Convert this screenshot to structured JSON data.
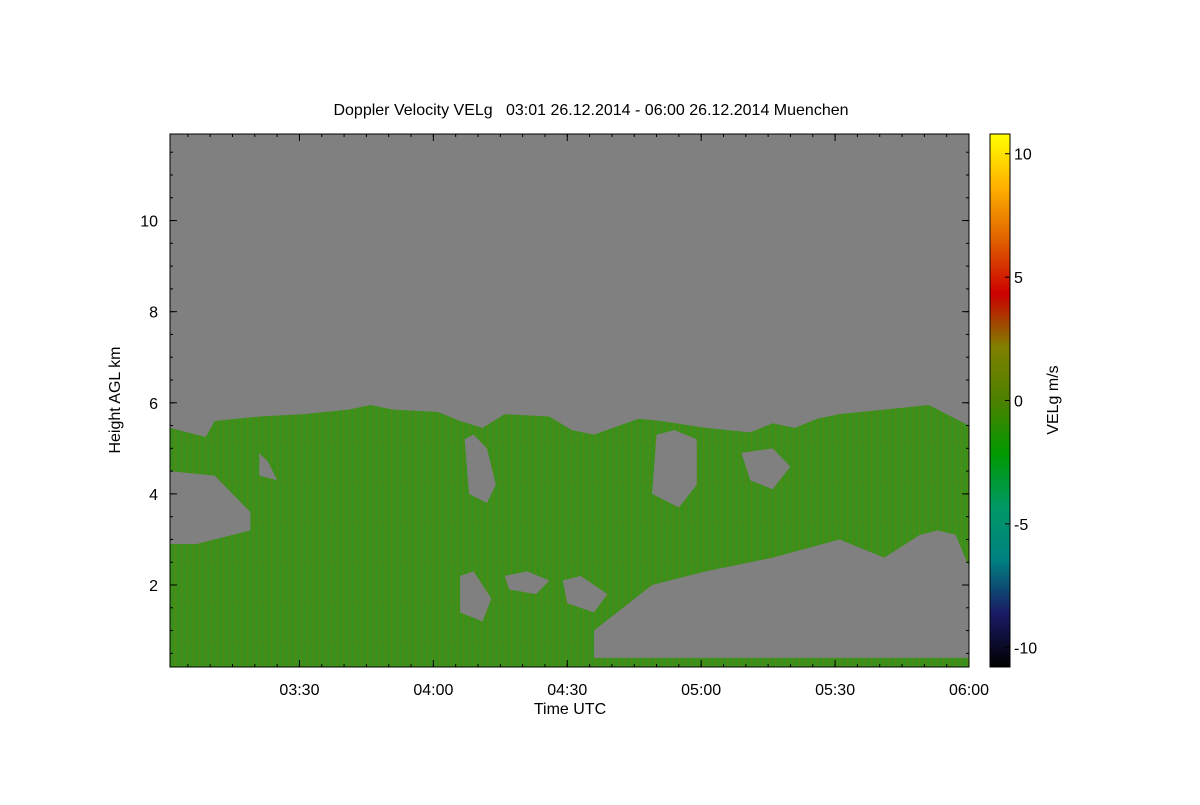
{
  "colors": {
    "background": "#ffffff",
    "no_signal_gray": "#808080",
    "axis": "#000000"
  },
  "chart_data": {
    "type": "heatmap",
    "title": "Doppler Velocity VELg   03:01 26.12.2014 - 06:00 26.12.2014 Muenchen",
    "xlabel": "Time UTC",
    "ylabel": "Height AGL km",
    "colorbar_label": "VELg m/s",
    "x_range": [
      "03:01",
      "06:00"
    ],
    "x_ticks": [
      "03:30",
      "04:00",
      "04:30",
      "05:00",
      "05:30",
      "06:00"
    ],
    "x_tick_minutes": [
      29,
      59,
      89,
      119,
      149,
      179
    ],
    "x_total_minutes": 179,
    "ylim": [
      0.2,
      11.9
    ],
    "y_ticks": [
      "2",
      "4",
      "6",
      "8",
      "10"
    ],
    "y_tick_values": [
      2,
      4,
      6,
      8,
      10
    ],
    "clim": [
      -10.8,
      10.8
    ],
    "colorbar_ticks": [
      "10",
      "5",
      "0",
      "-5",
      "-10"
    ],
    "colorbar_tick_values": [
      10,
      5,
      0,
      -5,
      -10
    ],
    "colormap": [
      "#000000",
      "#1a1a66",
      "#008080",
      "#009966",
      "#009900",
      "#4d8000",
      "#808000",
      "#cc0000",
      "#e06000",
      "#ffb000",
      "#ffff00"
    ],
    "data_fill_color": "#3d8e1a",
    "no_signal_color": "#808080",
    "grid": false,
    "echo_top_km": [
      [
        0,
        5.45
      ],
      [
        8,
        5.25
      ],
      [
        10,
        5.6
      ],
      [
        20,
        5.7
      ],
      [
        30,
        5.75
      ],
      [
        40,
        5.85
      ],
      [
        45,
        5.95
      ],
      [
        50,
        5.85
      ],
      [
        60,
        5.8
      ],
      [
        65,
        5.6
      ],
      [
        70,
        5.45
      ],
      [
        75,
        5.75
      ],
      [
        85,
        5.7
      ],
      [
        90,
        5.4
      ],
      [
        95,
        5.3
      ],
      [
        105,
        5.65
      ],
      [
        110,
        5.6
      ],
      [
        120,
        5.45
      ],
      [
        130,
        5.35
      ],
      [
        135,
        5.55
      ],
      [
        140,
        5.45
      ],
      [
        145,
        5.65
      ],
      [
        150,
        5.75
      ],
      [
        160,
        5.85
      ],
      [
        170,
        5.95
      ],
      [
        175,
        5.7
      ],
      [
        179,
        5.5
      ]
    ],
    "clear_air_gaps_km": [
      {
        "t": [
          0,
          10,
          18,
          18,
          6,
          0
        ],
        "h": [
          4.5,
          4.4,
          3.6,
          3.2,
          2.9,
          2.9
        ]
      },
      {
        "t": [
          20,
          22,
          24,
          20
        ],
        "h": [
          4.9,
          4.7,
          4.3,
          4.4
        ]
      },
      {
        "t": [
          66,
          68,
          71,
          73,
          71,
          67
        ],
        "h": [
          5.2,
          5.3,
          5.0,
          4.2,
          3.8,
          4.0
        ]
      },
      {
        "t": [
          109,
          113,
          118,
          118,
          114,
          108
        ],
        "h": [
          5.3,
          5.4,
          5.2,
          4.2,
          3.7,
          4.0
        ]
      },
      {
        "t": [
          128,
          135,
          139,
          135,
          130
        ],
        "h": [
          4.9,
          5.0,
          4.6,
          4.1,
          4.3
        ]
      },
      {
        "t": [
          95,
          108,
          120,
          135,
          150,
          160,
          168,
          172,
          176,
          179,
          179,
          95
        ],
        "h": [
          1.0,
          2.0,
          2.3,
          2.6,
          3.0,
          2.6,
          3.1,
          3.2,
          3.1,
          2.4,
          0.4,
          0.4
        ]
      },
      {
        "t": [
          65,
          68,
          72,
          70,
          65
        ],
        "h": [
          2.2,
          2.3,
          1.7,
          1.2,
          1.4
        ]
      },
      {
        "t": [
          75,
          80,
          85,
          82,
          76
        ],
        "h": [
          2.2,
          2.3,
          2.1,
          1.8,
          1.9
        ]
      },
      {
        "t": [
          88,
          92,
          98,
          95,
          89
        ],
        "h": [
          2.1,
          2.2,
          1.8,
          1.4,
          1.6
        ]
      }
    ]
  }
}
